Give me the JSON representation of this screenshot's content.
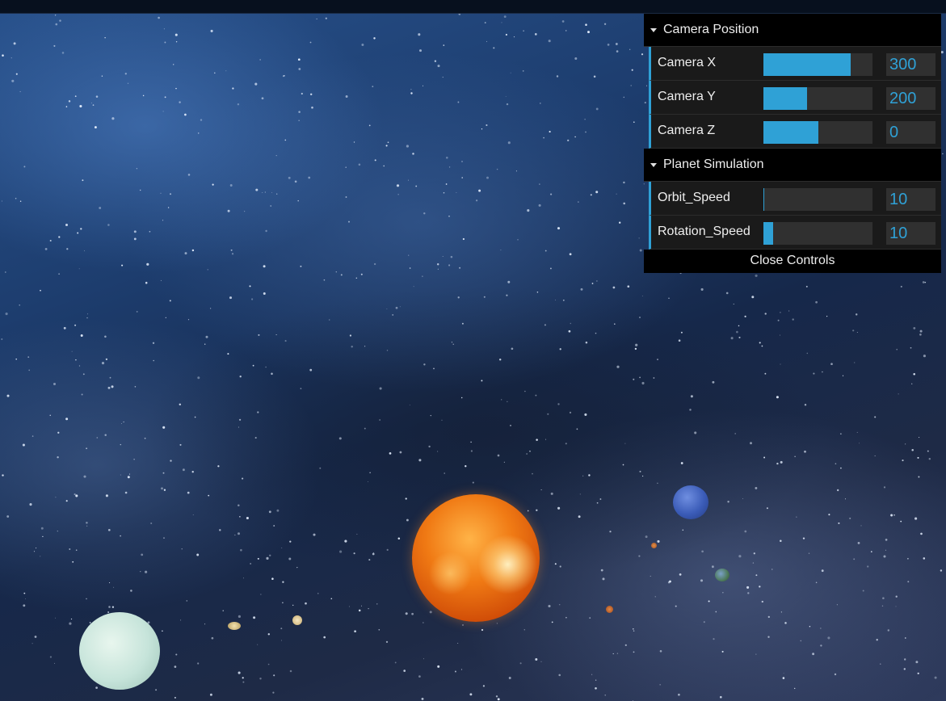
{
  "gui": {
    "folders": [
      {
        "title": "Camera Position",
        "controls": [
          {
            "label": "Camera X",
            "value": "300",
            "fill_fraction": 0.8
          },
          {
            "label": "Camera Y",
            "value": "200",
            "fill_fraction": 0.4
          },
          {
            "label": "Camera Z",
            "value": "0",
            "fill_fraction": 0.5
          }
        ]
      },
      {
        "title": "Planet Simulation",
        "controls": [
          {
            "label": "Orbit_Speed",
            "value": "10",
            "fill_fraction": 0.01
          },
          {
            "label": "Rotation_Speed",
            "value": "10",
            "fill_fraction": 0.09
          }
        ]
      }
    ],
    "close_label": "Close Controls"
  },
  "colors": {
    "accent": "#2fa1d6",
    "panel_bg": "#1a1a1a",
    "title_bg": "#000000",
    "sun": "#f07a14",
    "uranus": "#c6e4da",
    "neptune": "#3b5cb8"
  }
}
